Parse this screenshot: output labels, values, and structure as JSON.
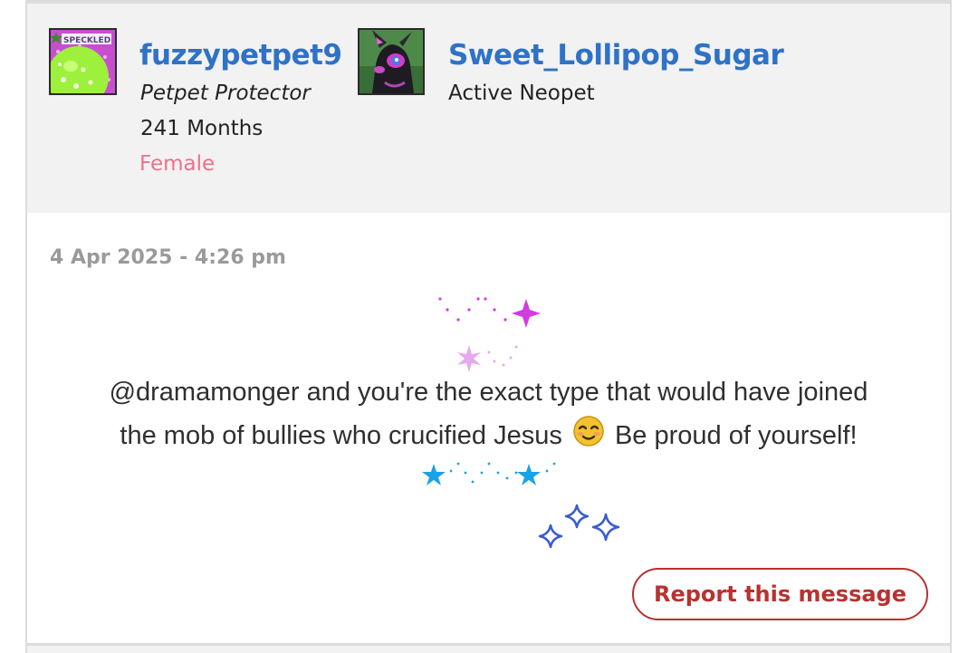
{
  "author": {
    "username": "fuzzypetpet9",
    "title": "Petpet Protector",
    "tenure": "241 Months",
    "gender": "Female",
    "avatar_badge_text": "SPECKLED"
  },
  "pet": {
    "name": "Sweet_Lollipop_Sugar",
    "status": "Active Neopet"
  },
  "post": {
    "timestamp": "4 Apr 2025 - 4:26 pm",
    "line1": "@dramamonger and you're the exact type that would have joined",
    "line2_before": "the mob of bullies who crucified Jesus",
    "line2_after": "Be proud of yourself!"
  },
  "actions": {
    "report_label": "Report this message"
  },
  "colors": {
    "username": "#2f72c6",
    "gender": "#f07089",
    "report": "#b8322f",
    "header_bg": "#f2f2f2",
    "sparkle_magenta": "#d23be0",
    "sparkle_pink": "#e6a9f0",
    "sparkle_cyan": "#19a3e6",
    "sparkle_blue": "#3a5bd0"
  }
}
